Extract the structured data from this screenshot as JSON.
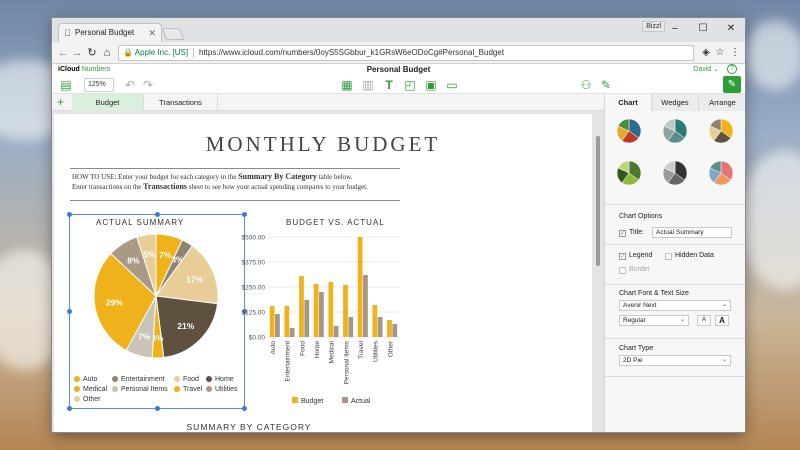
{
  "browser": {
    "tab_title": "Personal Budget",
    "user_badge": "Bizzl",
    "window_controls": {
      "minimize": "–",
      "maximize": "☐",
      "close": "✕"
    },
    "secure_label": "Apple Inc. [US]",
    "url": "https://www.icloud.com/numbers/0oyS5SGbbur_k1GRsW6eODoCg#Personal_Budget"
  },
  "app": {
    "brand_prefix": "iCloud",
    "brand_name": "Numbers",
    "document_title": "Personal Budget",
    "user_menu": "David ⌄",
    "help_label": "?"
  },
  "toolbar": {
    "zoom": "125% ⌄"
  },
  "sheet_tabs": [
    {
      "label": "Budget",
      "active": true
    },
    {
      "label": "Transactions",
      "active": false
    }
  ],
  "document": {
    "title": "MONTHLY BUDGET",
    "howto": {
      "p1": "HOW TO USE: Enter your budget for each category in the ",
      "b1": "Summary By Category",
      "p2": " table below.",
      "p3": "Enter transactions on the ",
      "b2": "Transactions",
      "p4": " sheet to see how your actual spending compares to your budget."
    },
    "pie_title": "ACTUAL SUMMARY",
    "bar_title": "BUDGET VS. ACTUAL",
    "summary_title": "SUMMARY BY CATEGORY"
  },
  "chart_data": [
    {
      "type": "pie",
      "title": "ACTUAL SUMMARY",
      "slices": [
        {
          "label": "Auto",
          "value": 7,
          "color": "#f0b21b"
        },
        {
          "label": "Entertainment",
          "value": 3,
          "color": "#8f8372"
        },
        {
          "label": "Food",
          "value": 17,
          "color": "#e9cd96"
        },
        {
          "label": "Home",
          "value": 21,
          "color": "#5e5140"
        },
        {
          "label": "Medical",
          "value": 3,
          "color": "#f0b21b"
        },
        {
          "label": "Personal Items",
          "value": 7,
          "color": "#c9c3b8"
        },
        {
          "label": "Travel",
          "value": 29,
          "color": "#f0b21b"
        },
        {
          "label": "Utilities",
          "value": 8,
          "color": "#a99985"
        },
        {
          "label": "Other",
          "value": 5,
          "color": "#e9cd96"
        }
      ],
      "legend": [
        "Auto",
        "Entertainment",
        "Food",
        "Home",
        "Medical",
        "Personal Items",
        "Travel",
        "Utilities",
        "Other"
      ],
      "legend_colors": [
        "#f0b21b",
        "#8f8372",
        "#e9cd96",
        "#5e5140",
        "#f0b21b",
        "#c9c3b8",
        "#f0b21b",
        "#a99985",
        "#e9cd96"
      ]
    },
    {
      "type": "bar",
      "title": "BUDGET VS. ACTUAL",
      "categories": [
        "Auto",
        "Entertainment",
        "Food",
        "Home",
        "Medical",
        "Personal Items",
        "Travel",
        "Utilities",
        "Other"
      ],
      "series": [
        {
          "name": "Budget",
          "color": "#f0b21b",
          "values": [
            155,
            155,
            305,
            265,
            275,
            260,
            500,
            160,
            85
          ]
        },
        {
          "name": "Actual",
          "color": "#a59787",
          "values": [
            115,
            45,
            185,
            225,
            55,
            100,
            310,
            100,
            65
          ]
        }
      ],
      "ylim": [
        0,
        500
      ],
      "yticks": [
        "$0.00",
        "$125.00",
        "$250.00",
        "$375.00",
        "$500.00"
      ],
      "ytick_values": [
        0,
        125,
        250,
        375,
        500
      ]
    }
  ],
  "panel": {
    "tabs": [
      "Chart",
      "Wedges",
      "Arrange"
    ],
    "chart_options_heading": "Chart Options",
    "title_label": "Title:",
    "title_value": "Actual Summary",
    "legend_label": "Legend",
    "hidden_data_label": "Hidden Data",
    "border_label": "Border",
    "font_heading": "Chart Font & Text Size",
    "font_value": "Avenir Next",
    "style_value": "Regular",
    "font_small": "A",
    "font_large": "A",
    "chart_type_heading": "Chart Type",
    "chart_type_value": "2D Pie",
    "style_swatches": [
      [
        "#2f6a8f",
        "#c0392b",
        "#e5a92b",
        "#4b8c3a"
      ],
      [
        "#2b7a78",
        "#5e8c8a",
        "#8fa3a3",
        "#c0c7c7"
      ],
      [
        "#f0b21b",
        "#5e5140",
        "#e9cd96",
        "#8f8372"
      ],
      [
        "#4b7a2a",
        "#8dbb3c",
        "#2e5a1a",
        "#b9d67a"
      ],
      [
        "#333333",
        "#666666",
        "#999999",
        "#cccccc"
      ],
      [
        "#e57373",
        "#ef9a5b",
        "#7fa7c9",
        "#5c8f8a"
      ]
    ]
  }
}
